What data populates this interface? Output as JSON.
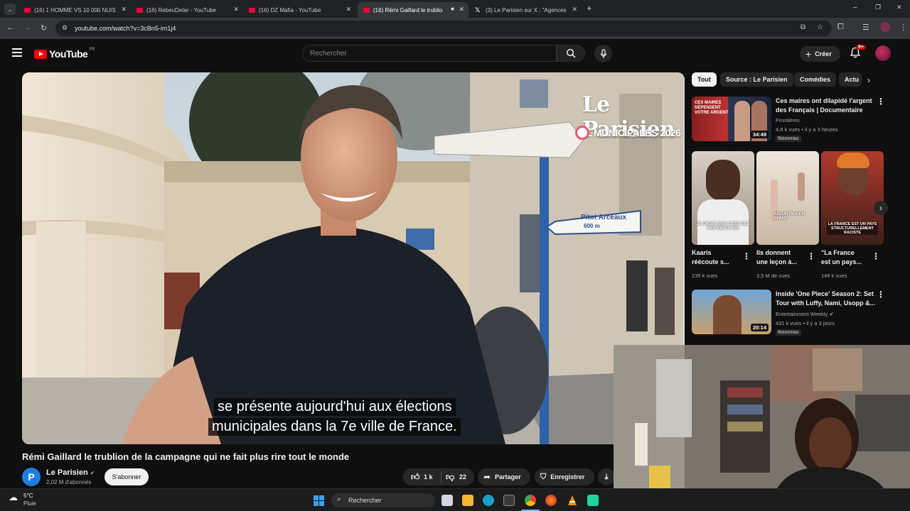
{
  "browser": {
    "tabs": [
      {
        "title": "(16) 1 HOMME VS 10 000 NUIS"
      },
      {
        "title": "(16) RebeuDeter - YouTube"
      },
      {
        "title": "(16) DZ Mafia - YouTube"
      },
      {
        "title": "(16) Rémi Gaillard le trublio"
      },
      {
        "title": "(3) Le Parisien sur X : \"Agences"
      }
    ],
    "url": "youtube.com/watch?v=3cBn5-im1j4"
  },
  "youtube": {
    "logo_text": "YouTube",
    "region": "FR",
    "search_placeholder": "Rechercher",
    "create_label": "Créer",
    "notification_count": "9+"
  },
  "video": {
    "overlay_brand": "Le Parisien",
    "overlay_sub": "MUNICIPALES 2026",
    "street_sign": "Pitot Arceaux",
    "street_sign_dist": "600 m",
    "subtitle_line1": "se présente aujourd'hui aux élections",
    "subtitle_line2": "municipales dans la 7e ville de France.",
    "title": "Rémi Gaillard le trublion de la campagne qui ne fait plus rire tout le monde",
    "channel_initial": "P",
    "channel": "Le Parisien",
    "subscribers": "2,02 M d'abonnés",
    "subscribe_label": "S'abonner",
    "likes": "1 k",
    "dislikes": "22",
    "share_label": "Partager",
    "save_label": "Enregistrer"
  },
  "sidebar": {
    "chips": [
      "Tout",
      "Source : Le Parisien",
      "Comédies",
      "Actu"
    ],
    "rec1": {
      "title_l1": "Ces maires ont dilapidé l'argent",
      "title_l2": "des Français | Documentaire",
      "channel": "Frontières",
      "meta": "4,8 k vues • il y a 3 heures",
      "badge": "Nouveau",
      "duration": "34:49",
      "thumb_text": "CES MAIRES DÉPENSENT VOTRE ARGENT"
    },
    "shorts": [
      {
        "title_l1": "Kaaris",
        "title_l2": "réécoute s...",
        "views": "235 k vues",
        "caption": "JE CROIS QUE C'EST DES MORCEAUX DE"
      },
      {
        "title_l1": "Ils donnent",
        "title_l2": "une leçon à...",
        "views": "3,5 M de vues",
        "caption": "AIS UN PAS EN AVANT"
      },
      {
        "title_l1": "\"La France",
        "title_l2": "est un pays...",
        "views": "149 k vues",
        "caption": "LA FRANCE EST UN PAYS STRUCTURELLEMENT RACISTE"
      }
    ],
    "rec2": {
      "title_l1": "Inside 'One Piece' Season 2: Set",
      "title_l2": "Tour with Luffy, Nami, Usopp &...",
      "channel": "Entertainment Weekly",
      "meta": "431 k vues • il y a 3 jours",
      "badge": "Nouveau",
      "duration": "20:14"
    }
  },
  "taskbar": {
    "temperature": "5°C",
    "weather": "Pluie",
    "search_label": "Rechercher"
  },
  "colors": {
    "yt_red": "#ff0000",
    "page_bg": "#0f0f0f",
    "chip_bg": "#272727"
  }
}
